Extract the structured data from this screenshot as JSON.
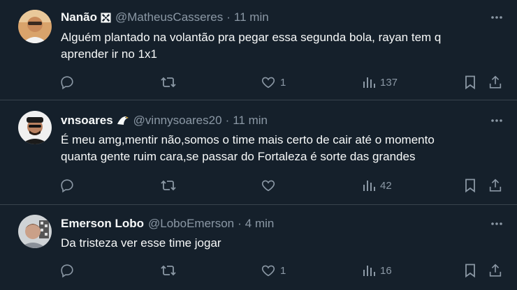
{
  "colors": {
    "background": "#15202b",
    "text_primary": "#f7f9f9",
    "text_secondary": "#8b98a5",
    "divider": "#38444d"
  },
  "tweets": [
    {
      "name": "Nanão",
      "badge_icon": "vasco-cross-icon",
      "handle": "@MatheusCasseres",
      "sep": "·",
      "time": "11 min",
      "text_lines": [
        "Alguém plantado na volantão pra pegar essa segunda bola, rayan tem q",
        "aprender ir no 1x1"
      ],
      "likes": "1",
      "views": "137"
    },
    {
      "name": "vnsoares",
      "badge_icon": "eagle-icon",
      "handle": "@vinnysoares20",
      "sep": "·",
      "time": "11 min",
      "text_lines": [
        "É meu amg,mentir não,somos o time mais certo de cair até o momento",
        "quanta gente ruim cara,se passar do Fortaleza é sorte das grandes"
      ],
      "likes": "",
      "views": "42"
    },
    {
      "name": "Emerson Lobo",
      "badge_icon": "",
      "handle": "@LoboEmerson",
      "sep": "·",
      "time": "4 min",
      "text_lines": [
        "Da tristeza ver esse time jogar"
      ],
      "likes": "1",
      "views": "16"
    }
  ]
}
